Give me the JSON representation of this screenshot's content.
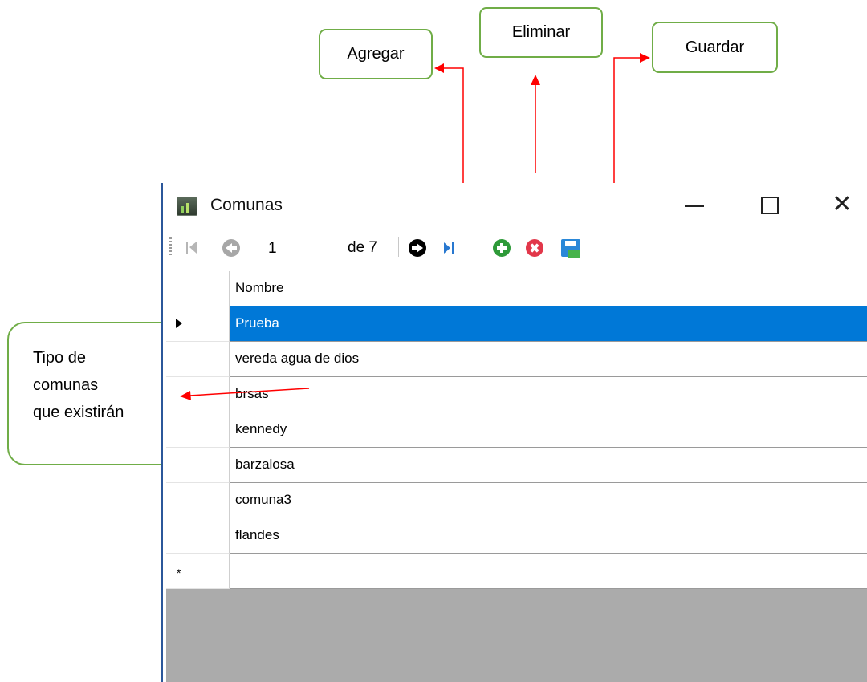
{
  "annotations": {
    "agregar": "Agregar",
    "eliminar": "Eliminar",
    "guardar": "Guardar",
    "tipo_lines": [
      "Tipo de",
      "comunas",
      "que existirán"
    ]
  },
  "colors": {
    "callout_border": "#70ad47",
    "arrow": "#ff0000",
    "selection": "#0078d7",
    "window_border": "#2b579a"
  },
  "window": {
    "title": "Comunas",
    "controls": [
      "minimize-icon",
      "maximize-icon",
      "close-icon"
    ],
    "close_glyph": "✕"
  },
  "toolbar": {
    "position_value": "1",
    "count_label": "de 7",
    "icons": [
      "move-first-icon",
      "move-previous-icon",
      "move-next-icon",
      "move-last-icon",
      "add-new-icon",
      "delete-icon",
      "save-icon"
    ]
  },
  "grid": {
    "column_header": "Nombre",
    "rows": [
      "Prueba",
      "vereda agua de dios",
      "brsas",
      "kennedy",
      "barzalosa",
      "comuna3",
      "flandes"
    ],
    "selected_index": 0,
    "new_row_marker": "*"
  }
}
